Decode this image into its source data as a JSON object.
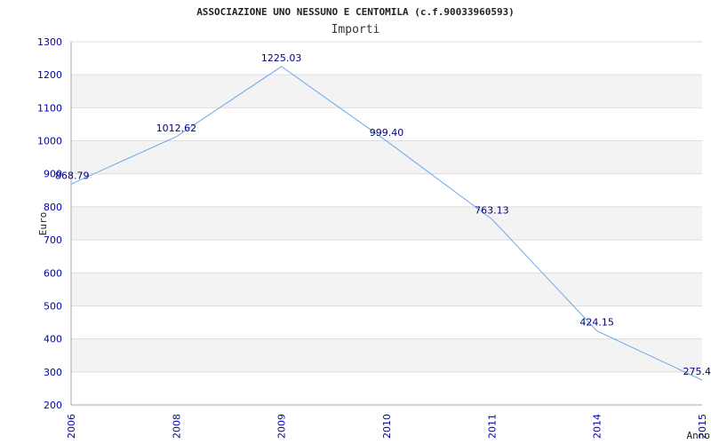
{
  "colors": {
    "line": "#6aa8e8",
    "tick_text": "#0000aa",
    "data_label": "#000080",
    "band_fill": "#f3f3f3",
    "grid": "#dddddd"
  },
  "chart_data": {
    "type": "line",
    "title": "ASSOCIAZIONE UNO NESSUNO E CENTOMILA (c.f.90033960593)",
    "subtitle": "Importi",
    "xlabel": "Anno",
    "ylabel": "Euro",
    "categories": [
      "2006",
      "2008",
      "2009",
      "2010",
      "2011",
      "2014",
      "2015"
    ],
    "series": [
      {
        "values": [
          868.79,
          1012.62,
          1225.03,
          999.4,
          763.13,
          424.15,
          275.4
        ],
        "labels": [
          "868.79",
          "1012.62",
          "1225.03",
          "999.40",
          "763.13",
          "424.15",
          "275.4"
        ]
      }
    ],
    "ylim": [
      200,
      1300
    ],
    "yticks": [
      200,
      300,
      400,
      500,
      600,
      700,
      800,
      900,
      1000,
      1100,
      1200,
      1300
    ],
    "grid": true,
    "legend": "none"
  }
}
